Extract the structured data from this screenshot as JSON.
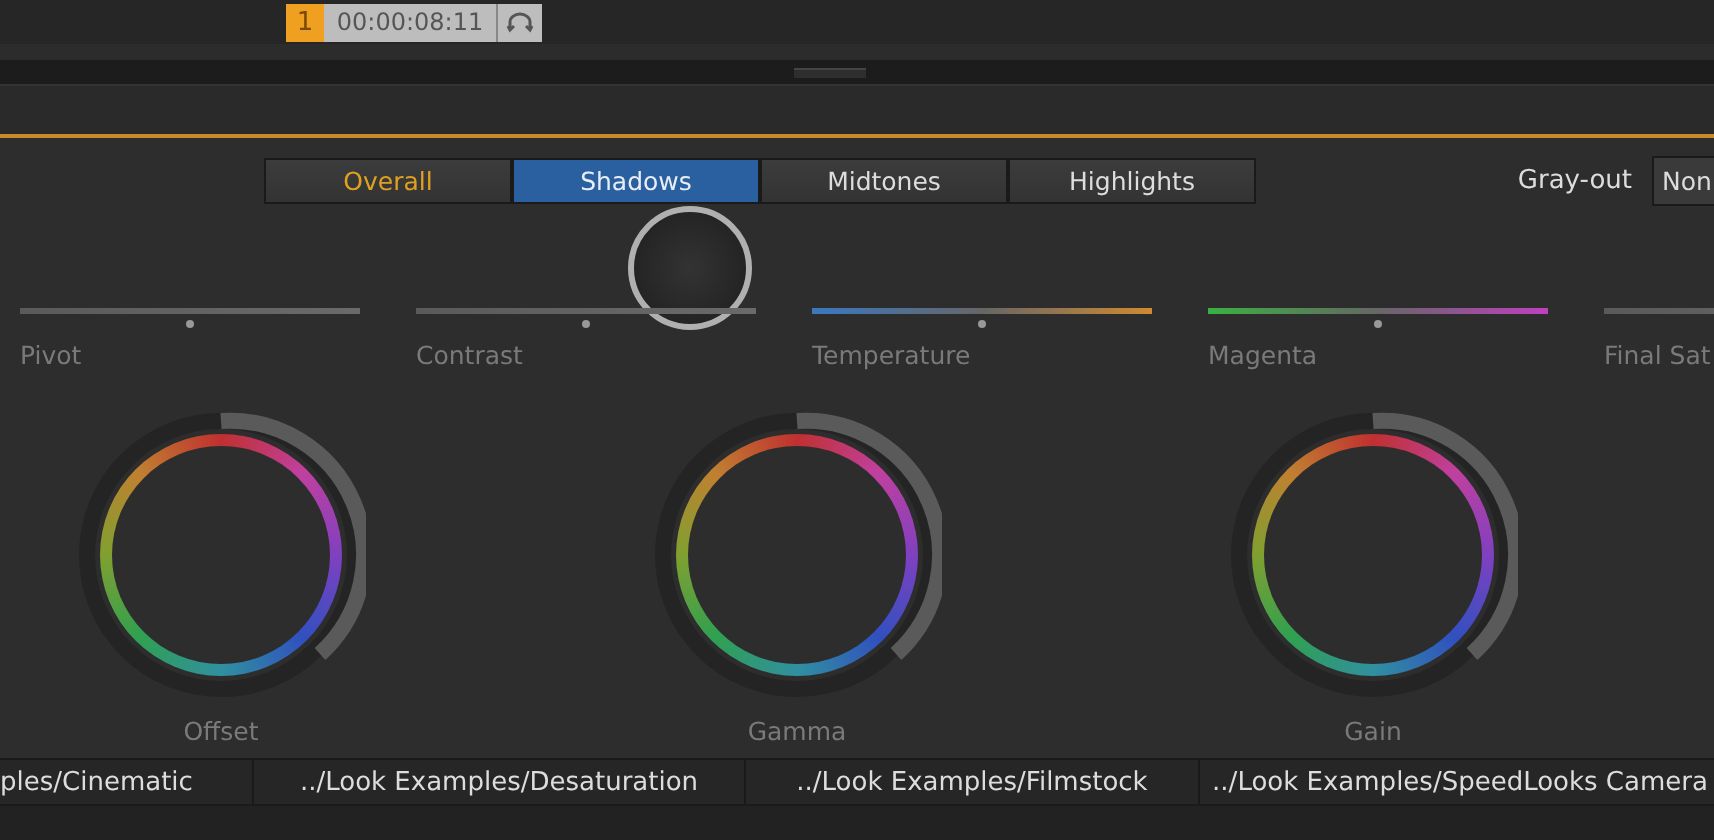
{
  "timecode": {
    "clip_number": "1",
    "time": "00:00:08:11"
  },
  "tabs": [
    {
      "label": "Overall",
      "selected": false
    },
    {
      "label": "Shadows",
      "selected": true
    },
    {
      "label": "Midtones",
      "selected": false
    },
    {
      "label": "Highlights",
      "selected": false
    }
  ],
  "gray_out": {
    "label": "Gray-out",
    "value": "Non"
  },
  "sliders": [
    {
      "label": "Pivot",
      "kind": "plain",
      "level": 0.5
    },
    {
      "label": "Contrast",
      "kind": "plain",
      "level": 0.5
    },
    {
      "label": "Temperature",
      "kind": "temperature",
      "level": 0.5
    },
    {
      "label": "Magenta",
      "kind": "tint",
      "level": 0.5
    },
    {
      "label": "Final Sat",
      "kind": "plain"
    }
  ],
  "wheels": [
    {
      "label": "Offset"
    },
    {
      "label": "Gamma"
    },
    {
      "label": "Gain"
    }
  ],
  "looks": [
    "ples/Cinematic",
    "../Look Examples/Desaturation",
    "../Look Examples/Filmstock",
    "../Look Examples/SpeedLooks Camera"
  ]
}
